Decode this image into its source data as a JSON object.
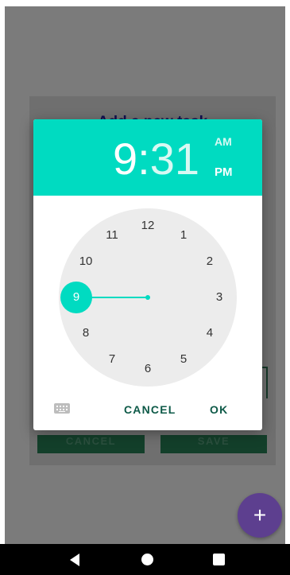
{
  "background": {
    "dialog_title": "Add a new task",
    "buttons": {
      "cancel": "CANCEL",
      "save": "SAVE"
    },
    "fab_icon": "plus-icon"
  },
  "time_picker": {
    "hour": "9",
    "colon": ":",
    "minute": "31",
    "am_label": "AM",
    "pm_label": "PM",
    "selected_period": "PM",
    "selected_hour": 9,
    "dial_numbers": [
      "12",
      "1",
      "2",
      "3",
      "4",
      "5",
      "6",
      "7",
      "8",
      "9",
      "10",
      "11"
    ],
    "keyboard_icon": "keyboard-icon",
    "cancel_label": "CANCEL",
    "ok_label": "OK"
  },
  "navbar": {
    "back_icon": "back-icon",
    "home_icon": "home-icon",
    "recents_icon": "recents-icon"
  },
  "colors": {
    "accent": "#00dbc1",
    "dial_bg": "#ececec",
    "button_text": "#0e5a48",
    "fab": "#5d3f8f",
    "scrim": "#7b7b7b"
  }
}
